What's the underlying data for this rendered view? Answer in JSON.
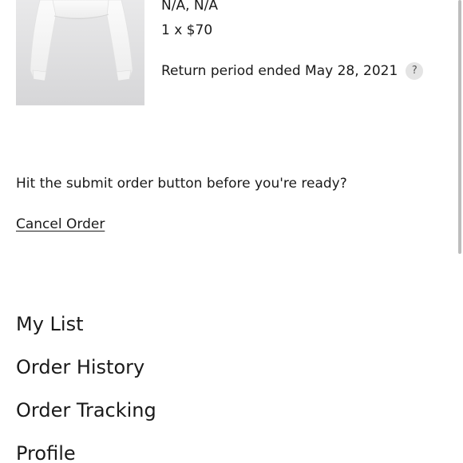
{
  "order_item": {
    "variant": "N/A, N/A",
    "quantity_price": "1 x $70",
    "return_status": "Return period ended May 28, 2021",
    "help_label": "?"
  },
  "cancel_section": {
    "prompt": "Hit the submit order button before you're ready?",
    "cancel_link": "Cancel Order"
  },
  "account_nav": {
    "items": [
      {
        "label": "My List"
      },
      {
        "label": "Order History"
      },
      {
        "label": "Order Tracking"
      },
      {
        "label": "Profile"
      }
    ]
  },
  "colors": {
    "background": "#ffffff",
    "text": "#1a1a1a",
    "image_bg": "#dedee0",
    "help_bg": "#e4e4e4"
  }
}
